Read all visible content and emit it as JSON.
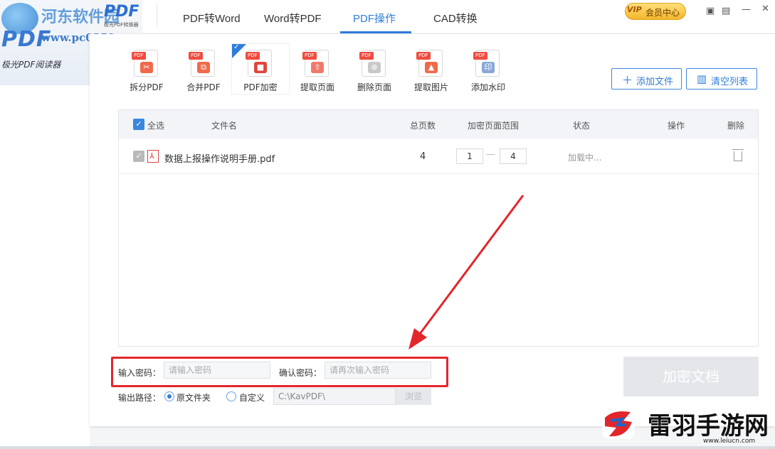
{
  "watermark": {
    "site_name": "河东软件园",
    "site_url": "www.pc0359.cn",
    "app_logo_text": "PDF",
    "app_subtitle": "极光PDF阅读器",
    "brand_logo": "PDF",
    "brand_sub": "极光PDF转换器"
  },
  "nav": {
    "tabs": [
      {
        "label": "PDF转Word"
      },
      {
        "label": "Word转PDF"
      },
      {
        "label": "PDF操作"
      },
      {
        "label": "CAD转换"
      }
    ],
    "active_index": 2,
    "vip_badge": "VIP",
    "vip_label": "会员中心"
  },
  "tools": [
    {
      "label": "拆分PDF",
      "color": "#f06a4b",
      "glyph": "✂"
    },
    {
      "label": "合并PDF",
      "color": "#f06a4b",
      "glyph": "⧉"
    },
    {
      "label": "PDF加密",
      "color": "#e0453a",
      "glyph": "🔒"
    },
    {
      "label": "提取页面",
      "color": "#f07a6a",
      "glyph": "⇧"
    },
    {
      "label": "删除页面",
      "color": "#c9c9c9",
      "glyph": "⊗"
    },
    {
      "label": "提取图片",
      "color": "#f06a4b",
      "glyph": "▲"
    },
    {
      "label": "添加水印",
      "color": "#8aa7d6",
      "glyph": "印"
    }
  ],
  "tool_tag": "PDF",
  "buttons": {
    "add_file": "添加文件",
    "clear_list": "清空列表",
    "encrypt": "加密文档",
    "browse": "浏览"
  },
  "table": {
    "headers": {
      "select_all": "全选",
      "filename": "文件名",
      "total_pages": "总页数",
      "page_range": "加密页面范围",
      "status": "状态",
      "action": "操作",
      "delete": "删除"
    },
    "rows": [
      {
        "filename": "数据上报操作说明手册.pdf",
        "total_pages": "4",
        "range_from": "1",
        "range_to": "4",
        "status": "加载中..."
      }
    ]
  },
  "password": {
    "enter_label": "输入密码：",
    "enter_placeholder": "请输入密码",
    "confirm_label": "确认密码：",
    "confirm_placeholder": "请再次输入密码"
  },
  "output": {
    "label": "输出路径：",
    "option_source": "原文件夹",
    "option_custom": "自定义",
    "path": "C:\\KavPDF\\",
    "selected": "原文件夹"
  },
  "footer_brand": {
    "name": "雷羽手游网",
    "url": "www.leiucn.com"
  },
  "colors": {
    "accent": "#2f7ddb",
    "annotation_red": "#e3262b"
  }
}
